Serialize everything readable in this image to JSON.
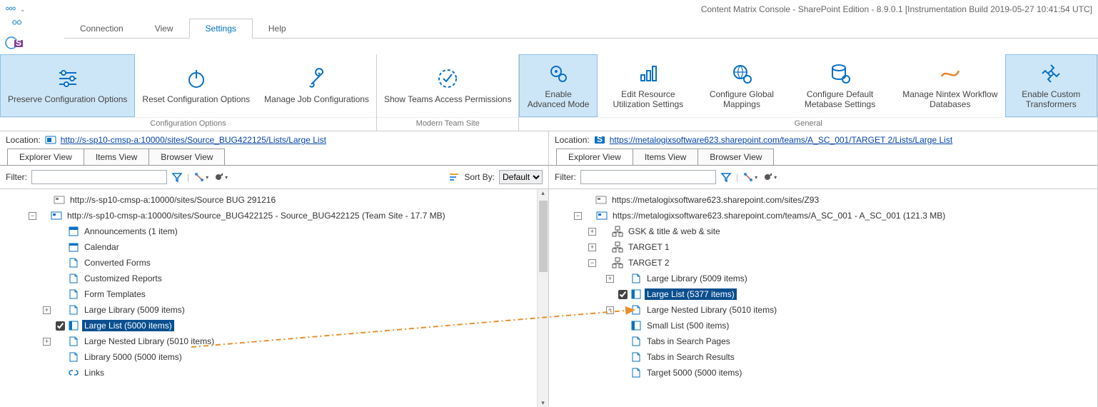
{
  "title": "Content Matrix Console - SharePoint Edition - 8.9.0.1 [Instrumentation Build 2019-05-27 10:41:54 UTC]",
  "tabs": {
    "connection": "Connection",
    "view": "View",
    "settings": "Settings",
    "help": "Help"
  },
  "ribbon": {
    "preserve": "Preserve Configuration Options",
    "reset": "Reset Configuration Options",
    "manage_job": "Manage Job Configurations",
    "group_config": "Configuration Options",
    "show_teams": "Show Teams Access Permissions",
    "group_modern": "Modern Team Site",
    "enable_adv": "Enable Advanced Mode",
    "edit_res": "Edit Resource Utilization Settings",
    "conf_global": "Configure Global Mappings",
    "conf_meta": "Configure Default Metabase Settings",
    "manage_nintex": "Manage Nintex Workflow Databases",
    "enable_trans": "Enable Custom Transformers",
    "group_general": "General"
  },
  "left": {
    "location_label": "Location:",
    "location_url": "http://s-sp10-cmsp-a:10000/sites/Source_BUG422125/Lists/Large List",
    "views": {
      "explorer": "Explorer View",
      "items": "Items View",
      "browser": "Browser View"
    },
    "filter_label": "Filter:",
    "sort_label": "Sort By:",
    "sort_value": "Default",
    "tree": {
      "root1": "http://s-sp10-cmsp-a:10000/sites/Source BUG 291216",
      "root2": "http://s-sp10-cmsp-a:10000/sites/Source_BUG422125 - Source_BUG422125 (Team Site - 17.7 MB)",
      "ann": "Announcements (1 item)",
      "cal": "Calendar",
      "conv": "Converted Forms",
      "cust": "Customized Reports",
      "form": "Form Templates",
      "llib": "Large Library (5009 items)",
      "llist": "Large List (5000 items)",
      "lnested": "Large Nested Library (5010 items)",
      "l5000": "Library 5000 (5000 items)",
      "links": "Links"
    }
  },
  "right": {
    "location_label": "Location:",
    "location_url": "https://metalogixsoftware623.sharepoint.com/teams/A_SC_001/TARGET 2/Lists/Large List",
    "views": {
      "explorer": "Explorer View",
      "items": "Items View",
      "browser": "Browser View"
    },
    "filter_label": "Filter:",
    "tree": {
      "root1": "https://metalogixsoftware623.sharepoint.com/sites/Z93",
      "root2": "https://metalogixsoftware623.sharepoint.com/teams/A_SC_001 - A_SC_001 (121.3 MB)",
      "gsk": "GSK &amp; title &amp; web &amp; site",
      "t1": "TARGET 1",
      "t2": "TARGET 2",
      "llib": "Large Library (5009 items)",
      "llist": "Large List (5377 items)",
      "lnested": "Large Nested Library (5010 items)",
      "small": "Small List (500 items)",
      "tabssp": "Tabs in Search Pages",
      "tabssr": "Tabs in Search Results",
      "t5000": "Target 5000 (5000 items)"
    }
  }
}
